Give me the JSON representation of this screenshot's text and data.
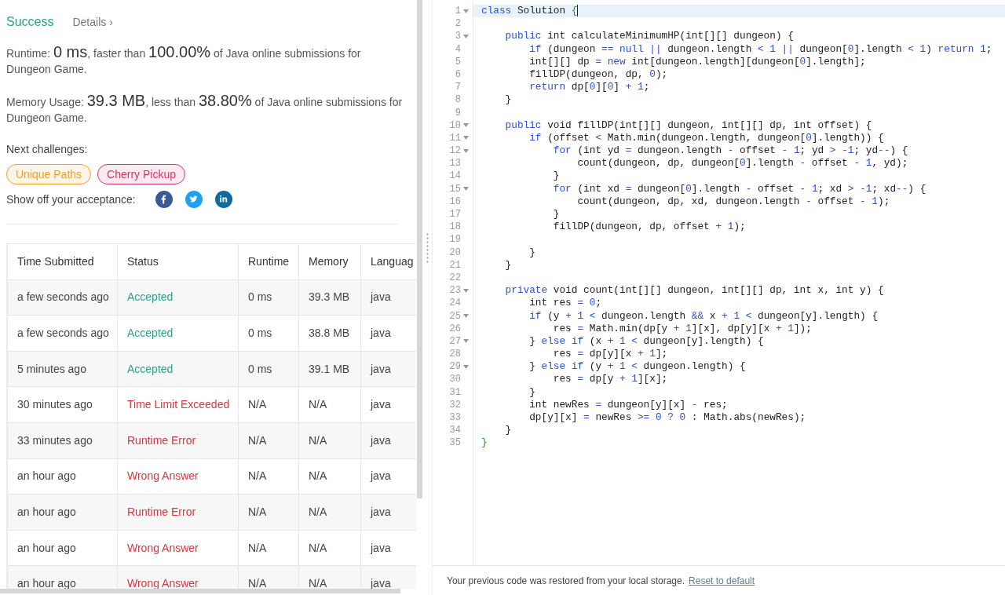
{
  "result": {
    "status": "Success",
    "details_link": "Details ›"
  },
  "stats": [
    {
      "label": "Runtime:",
      "value": "0 ms",
      "middle": ", faster than",
      "percent": "100.00%",
      "tail": "of Java online submissions for Dungeon Game."
    },
    {
      "label": "Memory Usage:",
      "value": "39.3 MB",
      "middle": ", less than",
      "percent": "38.80%",
      "tail": "of Java online submissions for Dungeon Game."
    }
  ],
  "next_challenges": {
    "label": "Next challenges:",
    "items": [
      {
        "title": "Unique Paths",
        "color": "#f0a020"
      },
      {
        "title": "Cherry Pickup",
        "color": "#d6336c"
      }
    ]
  },
  "share": {
    "label": "Show off your acceptance:",
    "buttons": [
      {
        "kind": "facebook"
      },
      {
        "kind": "twitter"
      },
      {
        "kind": "linkedin"
      }
    ]
  },
  "submissions": {
    "columns": [
      "Time Submitted",
      "Status",
      "Runtime",
      "Memory",
      "Languag"
    ],
    "rows": [
      {
        "time": "a few seconds ago",
        "status": "Accepted",
        "kind": "accepted",
        "runtime": "0 ms",
        "memory": "39.3 MB",
        "language": "java"
      },
      {
        "time": "a few seconds ago",
        "status": "Accepted",
        "kind": "accepted",
        "runtime": "0 ms",
        "memory": "38.8 MB",
        "language": "java"
      },
      {
        "time": "5 minutes ago",
        "status": "Accepted",
        "kind": "accepted",
        "runtime": "0 ms",
        "memory": "39.1 MB",
        "language": "java"
      },
      {
        "time": "30 minutes ago",
        "status": "Time Limit Exceeded",
        "kind": "error",
        "runtime": "N/A",
        "memory": "N/A",
        "language": "java"
      },
      {
        "time": "33 minutes ago",
        "status": "Runtime Error",
        "kind": "error",
        "runtime": "N/A",
        "memory": "N/A",
        "language": "java"
      },
      {
        "time": "an hour ago",
        "status": "Wrong Answer",
        "kind": "error",
        "runtime": "N/A",
        "memory": "N/A",
        "language": "java"
      },
      {
        "time": "an hour ago",
        "status": "Runtime Error",
        "kind": "error",
        "runtime": "N/A",
        "memory": "N/A",
        "language": "java"
      },
      {
        "time": "an hour ago",
        "status": "Wrong Answer",
        "kind": "error",
        "runtime": "N/A",
        "memory": "N/A",
        "language": "java"
      },
      {
        "time": "an hour ago",
        "status": "Wrong Answer",
        "kind": "error",
        "runtime": "N/A",
        "memory": "N/A",
        "language": "java"
      }
    ]
  },
  "editor": {
    "lines": [
      {
        "num": "1",
        "fold": true,
        "current": true,
        "tokens": [
          {
            "kind": "keyword",
            "text": "class"
          },
          {
            "kind": "plain",
            "text": " Solution "
          },
          {
            "kind": "match",
            "text": "{"
          }
        ]
      },
      {
        "num": "2",
        "fold": false,
        "current": false
      },
      {
        "num": "3",
        "fold": true,
        "current": false,
        "tokens": [
          {
            "kind": "keyword",
            "text": "    public"
          },
          {
            "kind": "plain",
            "text": " int calculateMinimumHP(int[][] dungeon) {"
          }
        ]
      },
      {
        "num": "4",
        "fold": false,
        "current": false,
        "tokens": [
          {
            "kind": "keyword",
            "text": "        if"
          },
          {
            "kind": "plain",
            "text": " (dungeon "
          },
          {
            "kind": "keyword",
            "text": "== null ||"
          },
          {
            "kind": "plain",
            "text": " dungeon.length "
          },
          {
            "kind": "keyword",
            "text": "< 1 ||"
          },
          {
            "kind": "plain",
            "text": " dungeon["
          },
          {
            "kind": "keyword",
            "text": "0"
          },
          {
            "kind": "plain",
            "text": "].length "
          },
          {
            "kind": "keyword",
            "text": "< 1"
          },
          {
            "kind": "plain",
            "text": ") "
          },
          {
            "kind": "keyword",
            "text": "return 1"
          },
          {
            "kind": "plain",
            "text": ";"
          }
        ]
      },
      {
        "num": "5",
        "fold": false,
        "current": false,
        "tokens": [
          {
            "kind": "plain",
            "text": "        int[][] dp "
          },
          {
            "kind": "keyword",
            "text": "= new"
          },
          {
            "kind": "plain",
            "text": " int[dungeon.length][dungeon["
          },
          {
            "kind": "keyword",
            "text": "0"
          },
          {
            "kind": "plain",
            "text": "].length];"
          }
        ]
      },
      {
        "num": "6",
        "fold": false,
        "current": false,
        "tokens": [
          {
            "kind": "plain",
            "text": "        fillDP(dungeon, dp, "
          },
          {
            "kind": "keyword",
            "text": "0"
          },
          {
            "kind": "plain",
            "text": ");"
          }
        ]
      },
      {
        "num": "7",
        "fold": false,
        "current": false,
        "tokens": [
          {
            "kind": "keyword",
            "text": "        return"
          },
          {
            "kind": "plain",
            "text": " dp["
          },
          {
            "kind": "keyword",
            "text": "0"
          },
          {
            "kind": "plain",
            "text": "]["
          },
          {
            "kind": "keyword",
            "text": "0"
          },
          {
            "kind": "plain",
            "text": "] "
          },
          {
            "kind": "keyword",
            "text": "+ 1"
          },
          {
            "kind": "plain",
            "text": ";"
          }
        ]
      },
      {
        "num": "8",
        "fold": false,
        "current": false,
        "tokens": [
          {
            "kind": "plain",
            "text": "    }"
          }
        ]
      },
      {
        "num": "9",
        "fold": false,
        "current": false
      },
      {
        "num": "10",
        "fold": true,
        "current": false,
        "tokens": [
          {
            "kind": "keyword",
            "text": "    public"
          },
          {
            "kind": "plain",
            "text": " void fillDP(int[][] dungeon, int[][] dp, int offset) {"
          }
        ]
      },
      {
        "num": "11",
        "fold": true,
        "current": false,
        "tokens": [
          {
            "kind": "keyword",
            "text": "        if"
          },
          {
            "kind": "plain",
            "text": " (offset "
          },
          {
            "kind": "keyword",
            "text": "<"
          },
          {
            "kind": "plain",
            "text": " Math.min(dungeon.length, dungeon["
          },
          {
            "kind": "keyword",
            "text": "0"
          },
          {
            "kind": "plain",
            "text": "].length)) {"
          }
        ]
      },
      {
        "num": "12",
        "fold": true,
        "current": false,
        "tokens": [
          {
            "kind": "keyword",
            "text": "            for"
          },
          {
            "kind": "plain",
            "text": " (int yd "
          },
          {
            "kind": "keyword",
            "text": "="
          },
          {
            "kind": "plain",
            "text": " dungeon.length "
          },
          {
            "kind": "keyword",
            "text": "-"
          },
          {
            "kind": "plain",
            "text": " offset "
          },
          {
            "kind": "keyword",
            "text": "- 1"
          },
          {
            "kind": "plain",
            "text": "; yd "
          },
          {
            "kind": "keyword",
            "text": "> -1"
          },
          {
            "kind": "plain",
            "text": "; yd"
          },
          {
            "kind": "keyword",
            "text": "--"
          },
          {
            "kind": "plain",
            "text": ") {"
          }
        ]
      },
      {
        "num": "13",
        "fold": false,
        "current": false,
        "tokens": [
          {
            "kind": "plain",
            "text": "                count(dungeon, dp, dungeon["
          },
          {
            "kind": "keyword",
            "text": "0"
          },
          {
            "kind": "plain",
            "text": "].length "
          },
          {
            "kind": "keyword",
            "text": "-"
          },
          {
            "kind": "plain",
            "text": " offset "
          },
          {
            "kind": "keyword",
            "text": "- 1"
          },
          {
            "kind": "plain",
            "text": ", yd);"
          }
        ]
      },
      {
        "num": "14",
        "fold": false,
        "current": false,
        "tokens": [
          {
            "kind": "plain",
            "text": "            }"
          }
        ]
      },
      {
        "num": "15",
        "fold": true,
        "current": false,
        "tokens": [
          {
            "kind": "keyword",
            "text": "            for"
          },
          {
            "kind": "plain",
            "text": " (int xd "
          },
          {
            "kind": "keyword",
            "text": "="
          },
          {
            "kind": "plain",
            "text": " dungeon["
          },
          {
            "kind": "keyword",
            "text": "0"
          },
          {
            "kind": "plain",
            "text": "].length "
          },
          {
            "kind": "keyword",
            "text": "-"
          },
          {
            "kind": "plain",
            "text": " offset "
          },
          {
            "kind": "keyword",
            "text": "- 1"
          },
          {
            "kind": "plain",
            "text": "; xd "
          },
          {
            "kind": "keyword",
            "text": "> -1"
          },
          {
            "kind": "plain",
            "text": "; xd"
          },
          {
            "kind": "keyword",
            "text": "--"
          },
          {
            "kind": "plain",
            "text": ") {"
          }
        ]
      },
      {
        "num": "16",
        "fold": false,
        "current": false,
        "tokens": [
          {
            "kind": "plain",
            "text": "                count(dungeon, dp, xd, dungeon.length "
          },
          {
            "kind": "keyword",
            "text": "-"
          },
          {
            "kind": "plain",
            "text": " offset "
          },
          {
            "kind": "keyword",
            "text": "- 1"
          },
          {
            "kind": "plain",
            "text": ");"
          }
        ]
      },
      {
        "num": "17",
        "fold": false,
        "current": false,
        "tokens": [
          {
            "kind": "plain",
            "text": "            }"
          }
        ]
      },
      {
        "num": "18",
        "fold": false,
        "current": false,
        "tokens": [
          {
            "kind": "plain",
            "text": "            fillDP(dungeon, dp, offset "
          },
          {
            "kind": "keyword",
            "text": "+ 1"
          },
          {
            "kind": "plain",
            "text": ");"
          }
        ]
      },
      {
        "num": "19",
        "fold": false,
        "current": false
      },
      {
        "num": "20",
        "fold": false,
        "current": false,
        "tokens": [
          {
            "kind": "plain",
            "text": "        }"
          }
        ]
      },
      {
        "num": "21",
        "fold": false,
        "current": false,
        "tokens": [
          {
            "kind": "plain",
            "text": "    }"
          }
        ]
      },
      {
        "num": "22",
        "fold": false,
        "current": false
      },
      {
        "num": "23",
        "fold": true,
        "current": false,
        "tokens": [
          {
            "kind": "keyword",
            "text": "    private"
          },
          {
            "kind": "plain",
            "text": " void count(int[][] dungeon, int[][] dp, int x, int y) {"
          }
        ]
      },
      {
        "num": "24",
        "fold": false,
        "current": false,
        "tokens": [
          {
            "kind": "plain",
            "text": "        int res "
          },
          {
            "kind": "keyword",
            "text": "= 0"
          },
          {
            "kind": "plain",
            "text": ";"
          }
        ]
      },
      {
        "num": "25",
        "fold": true,
        "current": false,
        "tokens": [
          {
            "kind": "keyword",
            "text": "        if"
          },
          {
            "kind": "plain",
            "text": " (y "
          },
          {
            "kind": "keyword",
            "text": "+ 1 <"
          },
          {
            "kind": "plain",
            "text": " dungeon.length "
          },
          {
            "kind": "keyword",
            "text": "&&"
          },
          {
            "kind": "plain",
            "text": " x "
          },
          {
            "kind": "keyword",
            "text": "+ 1 <"
          },
          {
            "kind": "plain",
            "text": " dungeon[y].length) {"
          }
        ]
      },
      {
        "num": "26",
        "fold": false,
        "current": false,
        "tokens": [
          {
            "kind": "plain",
            "text": "            res "
          },
          {
            "kind": "keyword",
            "text": "="
          },
          {
            "kind": "plain",
            "text": " Math.min(dp[y "
          },
          {
            "kind": "keyword",
            "text": "+ 1"
          },
          {
            "kind": "plain",
            "text": "][x], dp[y][x "
          },
          {
            "kind": "keyword",
            "text": "+ 1"
          },
          {
            "kind": "plain",
            "text": "]);"
          }
        ]
      },
      {
        "num": "27",
        "fold": true,
        "current": false,
        "tokens": [
          {
            "kind": "plain",
            "text": "        } "
          },
          {
            "kind": "keyword",
            "text": "else if"
          },
          {
            "kind": "plain",
            "text": " (x "
          },
          {
            "kind": "keyword",
            "text": "+ 1 <"
          },
          {
            "kind": "plain",
            "text": " dungeon[y].length) {"
          }
        ]
      },
      {
        "num": "28",
        "fold": false,
        "current": false,
        "tokens": [
          {
            "kind": "plain",
            "text": "            res "
          },
          {
            "kind": "keyword",
            "text": "="
          },
          {
            "kind": "plain",
            "text": " dp[y][x "
          },
          {
            "kind": "keyword",
            "text": "+ 1"
          },
          {
            "kind": "plain",
            "text": "];"
          }
        ]
      },
      {
        "num": "29",
        "fold": true,
        "current": false,
        "tokens": [
          {
            "kind": "plain",
            "text": "        } "
          },
          {
            "kind": "keyword",
            "text": "else if"
          },
          {
            "kind": "plain",
            "text": " (y "
          },
          {
            "kind": "keyword",
            "text": "+ 1 <"
          },
          {
            "kind": "plain",
            "text": " dungeon.length) {"
          }
        ]
      },
      {
        "num": "30",
        "fold": false,
        "current": false,
        "tokens": [
          {
            "kind": "plain",
            "text": "            res "
          },
          {
            "kind": "keyword",
            "text": "="
          },
          {
            "kind": "plain",
            "text": " dp[y "
          },
          {
            "kind": "keyword",
            "text": "+ 1"
          },
          {
            "kind": "plain",
            "text": "][x];"
          }
        ]
      },
      {
        "num": "31",
        "fold": false,
        "current": false,
        "tokens": [
          {
            "kind": "plain",
            "text": "        }"
          }
        ]
      },
      {
        "num": "32",
        "fold": false,
        "current": false,
        "tokens": [
          {
            "kind": "plain",
            "text": "        int newRes "
          },
          {
            "kind": "keyword",
            "text": "="
          },
          {
            "kind": "plain",
            "text": " dungeon[y][x] "
          },
          {
            "kind": "keyword",
            "text": "-"
          },
          {
            "kind": "plain",
            "text": " res;"
          }
        ]
      },
      {
        "num": "33",
        "fold": false,
        "current": false,
        "tokens": [
          {
            "kind": "plain",
            "text": "        dp[y][x] "
          },
          {
            "kind": "keyword",
            "text": "="
          },
          {
            "kind": "plain",
            "text": " newRes "
          },
          {
            "kind": "keyword",
            "text": ">= 0 ? 0"
          },
          {
            "kind": "plain",
            "text": " : Math.abs(newRes);"
          }
        ]
      },
      {
        "num": "34",
        "fold": false,
        "current": false,
        "tokens": [
          {
            "kind": "plain",
            "text": "    }"
          }
        ]
      },
      {
        "num": "35",
        "fold": false,
        "current": false,
        "tokens": [
          {
            "kind": "match",
            "text": "}"
          }
        ]
      }
    ]
  },
  "footer": {
    "message": "Your previous code was restored from your local storage.",
    "link": "Reset to default"
  }
}
